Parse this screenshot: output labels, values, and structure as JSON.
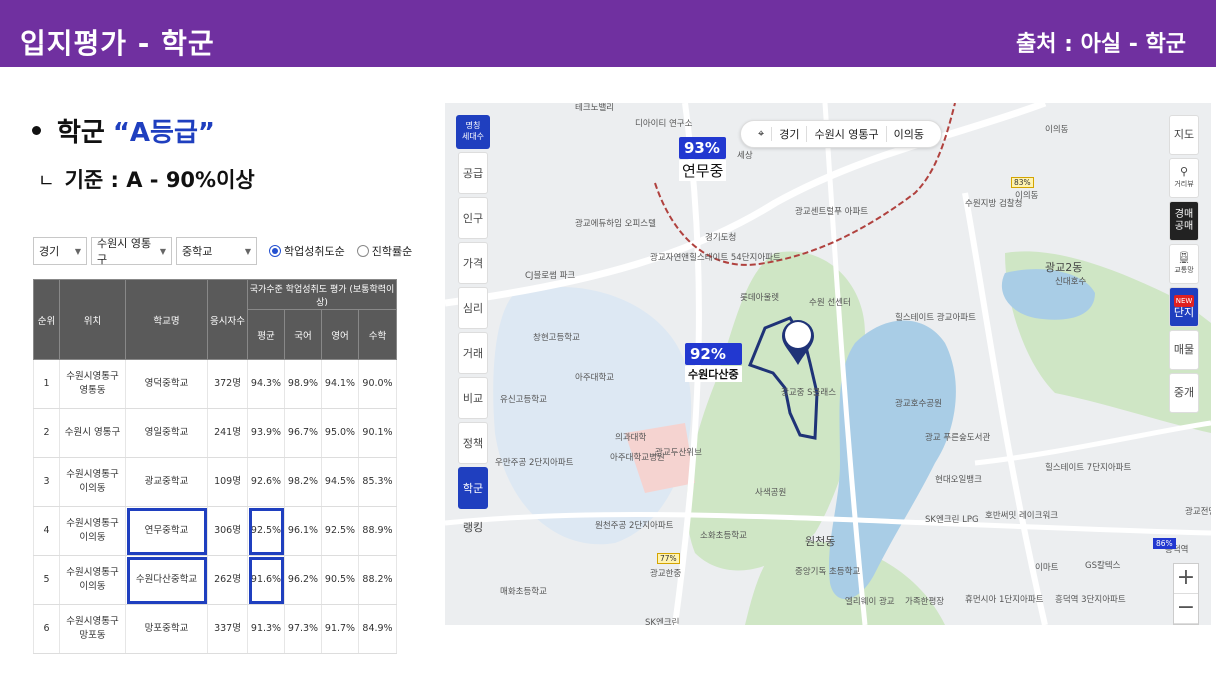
{
  "header": {
    "title": "입지평가 - 학군",
    "source": "출처 : 아실 - 학군",
    "color": "#7030a0"
  },
  "bullet": {
    "label": "학군",
    "grade": "“A등급”"
  },
  "criteria": {
    "corner": "ㄴ",
    "text": "기준 : A - 90%이상"
  },
  "filters": {
    "region": "경기",
    "district": "수원시 영통구",
    "school_type": "중학교",
    "radio_1": "학업성취도순",
    "radio_2": "진학률순"
  },
  "table": {
    "headers": {
      "rank": "순위",
      "location": "위치",
      "school": "학교명",
      "students": "응시자수",
      "group": "국가수준 학업성취도 평가 (보통학력이상)",
      "avg": "평균",
      "korean": "국어",
      "english": "영어",
      "math": "수학"
    },
    "rows": [
      {
        "rank": "1",
        "location": "수원시영통구 영통동",
        "school": "영덕중학교",
        "students": "372명",
        "avg": "94.3%",
        "korean": "98.9%",
        "english": "94.1%",
        "math": "90.0%"
      },
      {
        "rank": "2",
        "location": "수원시 영통구",
        "school": "영일중학교",
        "students": "241명",
        "avg": "93.9%",
        "korean": "96.7%",
        "english": "95.0%",
        "math": "90.1%"
      },
      {
        "rank": "3",
        "location": "수원시영통구 이의동",
        "school": "광교중학교",
        "students": "109명",
        "avg": "92.6%",
        "korean": "98.2%",
        "english": "94.5%",
        "math": "85.3%"
      },
      {
        "rank": "4",
        "location": "수원시영통구 이의동",
        "school": "연무중학교",
        "students": "306명",
        "avg": "92.5%",
        "korean": "96.1%",
        "english": "92.5%",
        "math": "88.9%"
      },
      {
        "rank": "5",
        "location": "수원시영통구 이의동",
        "school": "수원다산중학교",
        "students": "262명",
        "avg": "91.6%",
        "korean": "96.2%",
        "english": "90.5%",
        "math": "88.2%"
      },
      {
        "rank": "6",
        "location": "수원시영통구 망포동",
        "school": "망포중학교",
        "students": "337명",
        "avg": "91.3%",
        "korean": "97.3%",
        "english": "91.7%",
        "math": "84.9%"
      }
    ]
  },
  "map": {
    "location": [
      "경기",
      "수원시 영통구",
      "이의동"
    ],
    "left_top": [
      "명칭",
      "세대수"
    ],
    "left_menu": [
      "공급",
      "인구",
      "가격",
      "심리",
      "거래",
      "비교",
      "정책",
      "학군",
      "랭킹"
    ],
    "right_menu": [
      "지도",
      "거리뷰",
      "경매 공매",
      "교통망",
      "단지",
      "매물",
      "중개"
    ],
    "right_new": "NEW",
    "zoom_in": "+",
    "zoom_out": "−",
    "flag_1": {
      "pct": "93%",
      "name": "연무중"
    },
    "flag_2": {
      "pct": "92%",
      "name": "수원다산중"
    },
    "mini_1": "83%",
    "mini_2": "77%",
    "mini_3": "86%",
    "labels": [
      "테크노밸리",
      "디아이티 연구소",
      "세상",
      "광교호 카운티아파트",
      "이의동",
      "이의동",
      "수원지방 검찰청",
      "광교에듀하임 오피스텔",
      "광교센트럴푸 아파트",
      "경기도청",
      "광교자연앤힐스테이트 54단지아파트",
      "CJ블로썸 파크",
      "롯데아울렛",
      "수원 선센터",
      "광교2동",
      "신대호수",
      "창현고등학교",
      "힐스테이트 광교아파트",
      "아주대학교",
      "유신고등학교",
      "광교중 S클래스",
      "광교호수공원",
      "의과대학",
      "아주대학교병원",
      "우만주공 2단지아파트",
      "광교두산위브",
      "광교 푸른숲도서관",
      "힐스테이트 7단지아파트",
      "사색공원",
      "현대오일뱅크",
      "원천주공 2단지아파트",
      "소화초등학교",
      "SK엔크린 LPG",
      "호반써밋 레이크워크",
      "원천동",
      "중앙기독 초등학교",
      "엘리웨이 광교",
      "흥덕역",
      "GS칼텍스",
      "이마트",
      "매화초등학교",
      "광교한중",
      "휴먼시아 1단지아파트",
      "흥덕역 3단지아파트",
      "가족한평장",
      "SK엔크린",
      "광교전망 공원"
    ],
    "water_color": "#a9cde6",
    "park_color": "#cfe6c5"
  }
}
